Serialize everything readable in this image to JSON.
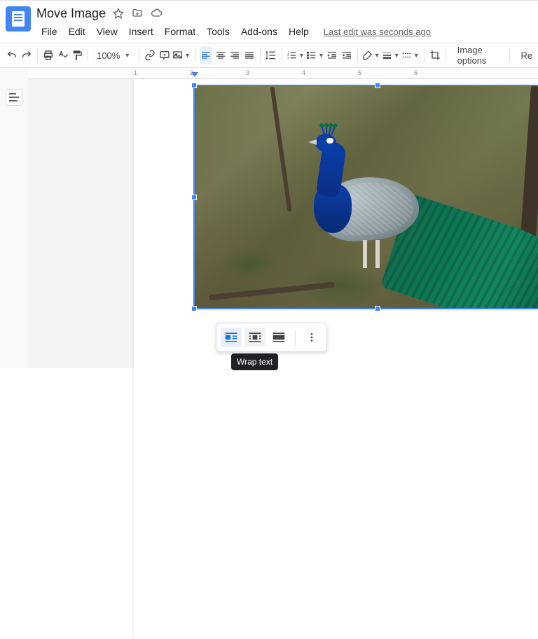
{
  "header": {
    "doc_title": "Move Image",
    "menus": [
      "File",
      "Edit",
      "View",
      "Insert",
      "Format",
      "Tools",
      "Add-ons",
      "Help"
    ],
    "last_edit": "Last edit was seconds ago"
  },
  "toolbar": {
    "zoom": "100%",
    "image_options": "Image options",
    "replace": "Re"
  },
  "ruler": {
    "ticks": [
      "1",
      "2",
      "3",
      "4",
      "5",
      "6"
    ]
  },
  "image_toolbar": {
    "tooltip": "Wrap text"
  }
}
